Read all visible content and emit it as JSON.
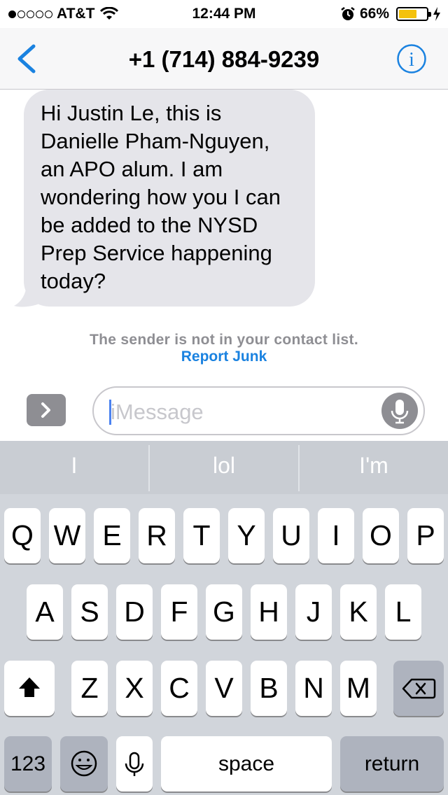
{
  "status_bar": {
    "carrier": "AT&T",
    "time": "12:44 PM",
    "battery_percent": "66%",
    "battery_level": 0.66,
    "signal_bars": 1,
    "signal_total": 5,
    "battery_color": "#f4c20d"
  },
  "nav": {
    "title": "+1 (714) 884-9239",
    "accent": "#1a82e0"
  },
  "messages": [
    {
      "direction": "incoming",
      "text": "Hi Justin Le, this is Danielle Pham-Nguyen, an APO alum. I am wondering how you I can be added to the NYSD Prep Service happening today?"
    }
  ],
  "notice": {
    "text": "The sender is not in your contact list.",
    "link": "Report Junk"
  },
  "composer": {
    "placeholder": "iMessage"
  },
  "keyboard": {
    "suggestions": [
      "I",
      "lol",
      "I'm"
    ],
    "row1": [
      "Q",
      "W",
      "E",
      "R",
      "T",
      "Y",
      "U",
      "I",
      "O",
      "P"
    ],
    "row2": [
      "A",
      "S",
      "D",
      "F",
      "G",
      "H",
      "J",
      "K",
      "L"
    ],
    "row3": [
      "Z",
      "X",
      "C",
      "V",
      "B",
      "N",
      "M"
    ],
    "numbers_label": "123",
    "space_label": "space",
    "return_label": "return"
  }
}
